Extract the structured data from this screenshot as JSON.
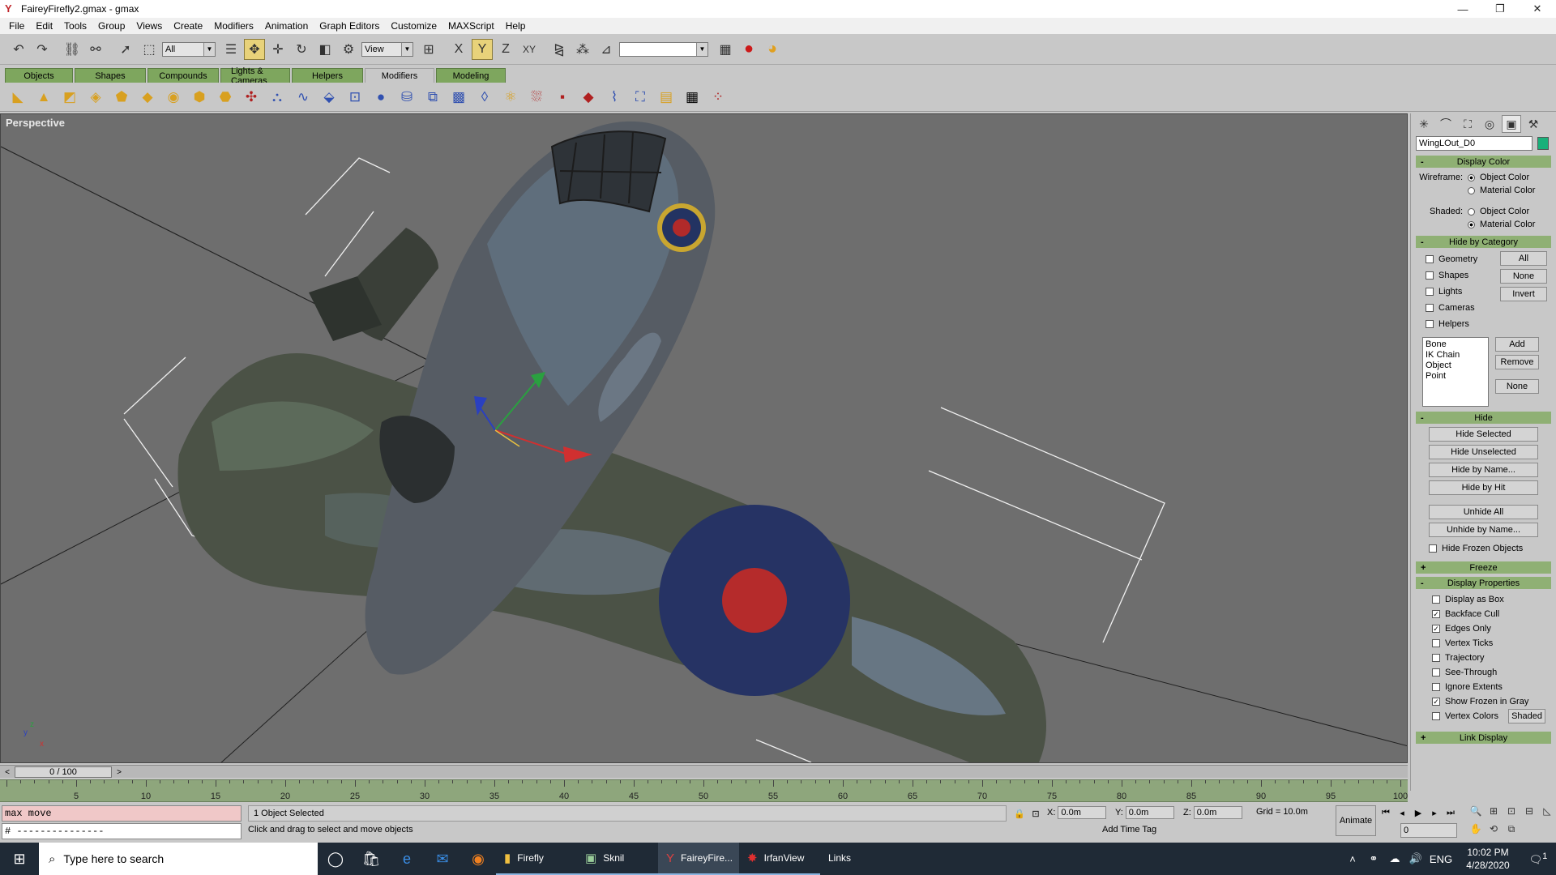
{
  "window": {
    "title": "FaireyFirefly2.gmax - gmax",
    "minimize": "—",
    "restore": "❐",
    "close": "✕"
  },
  "menu": [
    "File",
    "Edit",
    "Tools",
    "Group",
    "Views",
    "Create",
    "Modifiers",
    "Animation",
    "Graph Editors",
    "Customize",
    "MAXScript",
    "Help"
  ],
  "toolbar": {
    "selection_filter": "All",
    "reference_coord": "View",
    "named_selection": ""
  },
  "tabs": [
    {
      "label": "Objects",
      "active": false
    },
    {
      "label": "Shapes",
      "active": false
    },
    {
      "label": "Compounds",
      "active": false
    },
    {
      "label": "Lights & Cameras",
      "active": false
    },
    {
      "label": "Helpers",
      "active": false
    },
    {
      "label": "Modifiers",
      "active": true
    },
    {
      "label": "Modeling",
      "active": false
    }
  ],
  "viewport": {
    "label": "Perspective",
    "axis_z": "z",
    "axis_y": "y",
    "axis_x": "x"
  },
  "command_panel": {
    "object_name": "WingLOut_D0",
    "object_color": "#19b07a",
    "display_color": {
      "title": "Display Color",
      "wireframe_label": "Wireframe:",
      "shaded_label": "Shaded:",
      "object_color": "Object Color",
      "material_color": "Material Color"
    },
    "hide_by_category": {
      "title": "Hide by Category",
      "items": [
        "Geometry",
        "Shapes",
        "Lights",
        "Cameras",
        "Helpers"
      ],
      "buttons": [
        "All",
        "None",
        "Invert"
      ],
      "list": [
        "Bone",
        "IK Chain Object",
        "Point"
      ],
      "list_buttons": [
        "Add",
        "Remove",
        "None"
      ]
    },
    "hide": {
      "title": "Hide",
      "buttons": [
        "Hide Selected",
        "Hide Unselected",
        "Hide by Name...",
        "Hide by Hit",
        "Unhide All",
        "Unhide by Name..."
      ],
      "hide_frozen": "Hide Frozen Objects"
    },
    "freeze": {
      "title": "Freeze"
    },
    "display_properties": {
      "title": "Display Properties",
      "items": [
        {
          "label": "Display as Box",
          "checked": false
        },
        {
          "label": "Backface Cull",
          "checked": true
        },
        {
          "label": "Edges Only",
          "checked": true
        },
        {
          "label": "Vertex Ticks",
          "checked": false
        },
        {
          "label": "Trajectory",
          "checked": false
        },
        {
          "label": "See-Through",
          "checked": false
        },
        {
          "label": "Ignore Extents",
          "checked": false
        },
        {
          "label": "Show Frozen in Gray",
          "checked": true
        },
        {
          "label": "Vertex Colors",
          "checked": false
        }
      ],
      "shaded_button": "Shaded"
    },
    "link_display": {
      "title": "Link Display"
    }
  },
  "timeline": {
    "frame_label": "0 / 100",
    "ticks": [
      "5",
      "10",
      "15",
      "20",
      "25",
      "30",
      "35",
      "40",
      "45",
      "50",
      "55",
      "60",
      "65",
      "70",
      "75",
      "80",
      "85",
      "90",
      "95",
      "100"
    ]
  },
  "status": {
    "maxscript_line1": "max move",
    "maxscript_line2": "# ---------------",
    "selection_status": "1 Object Selected",
    "prompt": "Click and drag to select and move objects",
    "x_label": "X:",
    "x_value": "0.0m",
    "y_label": "Y:",
    "y_value": "0.0m",
    "z_label": "Z:",
    "z_value": "0.0m",
    "grid": "Grid = 10.0m",
    "add_time_tag": "Add Time Tag",
    "animate": "Animate",
    "current_frame": "0"
  },
  "taskbar": {
    "search_placeholder": "Type here to search",
    "apps": [
      {
        "label": "Firefly",
        "state": "running"
      },
      {
        "label": "Sknil",
        "state": "running"
      },
      {
        "label": "FaireyFire...",
        "state": "active"
      },
      {
        "label": "IrfanView",
        "state": "running"
      },
      {
        "label": "Links",
        "state": "none"
      }
    ],
    "language": "ENG",
    "time": "10:02 PM",
    "date": "4/28/2020",
    "notification_count": "1"
  }
}
